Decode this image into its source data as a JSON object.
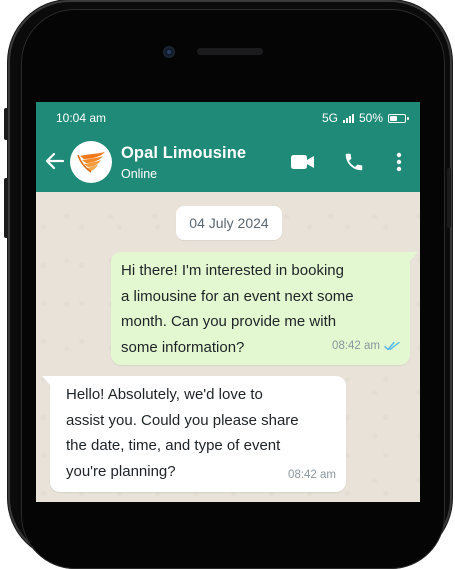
{
  "status_bar": {
    "time": "10:04 am",
    "network": "5G",
    "battery": "50%",
    "battery_level": 0.5
  },
  "header": {
    "contact_name": "Opal Limousine",
    "contact_status": "Online",
    "icons": [
      "back-arrow-icon",
      "video-call-icon",
      "phone-call-icon",
      "more-options-icon"
    ]
  },
  "chat": {
    "date": "04 July 2024",
    "messages": [
      {
        "direction": "outgoing",
        "text": "Hi there! I'm interested in booking\na limousine for an event next some\nmonth. Can you provide me with\nsome information?",
        "time": "08:42 am",
        "status": "read"
      },
      {
        "direction": "incoming",
        "text": "Hello! Absolutely, we'd love to\nassist you. Could you please share\nthe date, time, and type of event\nyou're planning?",
        "time": "08:42 am"
      }
    ]
  },
  "colors": {
    "header": "#1f8a77",
    "outgoing_bubble": "#e3f8d0",
    "incoming_bubble": "#ffffff",
    "read_ticks": "#4fb6ec",
    "logo_orange": "#f07a1a"
  }
}
